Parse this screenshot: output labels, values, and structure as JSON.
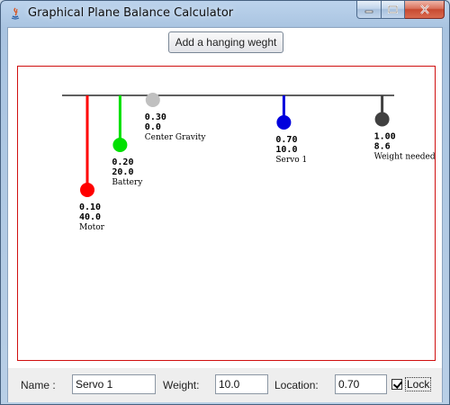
{
  "window": {
    "title": "Graphical Plane Balance Calculator",
    "icon": "java-icon"
  },
  "toolbar": {
    "add_weight_label": "Add a hanging weght"
  },
  "canvas": {
    "border_color": "#d01010",
    "beam_color": "#000000",
    "weights": [
      {
        "location": "0.10",
        "weight": "40.0",
        "name": "Motor",
        "color": "#ff0000",
        "location_value": 0.1,
        "weight_value": 40.0
      },
      {
        "location": "0.20",
        "weight": "20.0",
        "name": "Battery",
        "color": "#00e000",
        "location_value": 0.2,
        "weight_value": 20.0
      },
      {
        "location": "0.30",
        "weight": "0.0",
        "name": "Center Gravity",
        "color": "#c0c0c0",
        "location_value": 0.3,
        "weight_value": 0.0
      },
      {
        "location": "0.70",
        "weight": "10.0",
        "name": "Servo 1",
        "color": "#0000dd",
        "location_value": 0.7,
        "weight_value": 10.0
      },
      {
        "location": "1.00",
        "weight": "8.6",
        "name": "Weight needed",
        "color": "#404040",
        "location_value": 1.0,
        "weight_value": 8.6
      }
    ]
  },
  "form": {
    "name_label": "Name :",
    "name_value": "Servo 1",
    "weight_label": "Weight:",
    "weight_value": "10.0",
    "location_label": "Location:",
    "location_value": "0.70",
    "lock_label": "Lock",
    "lock_checked": true
  }
}
